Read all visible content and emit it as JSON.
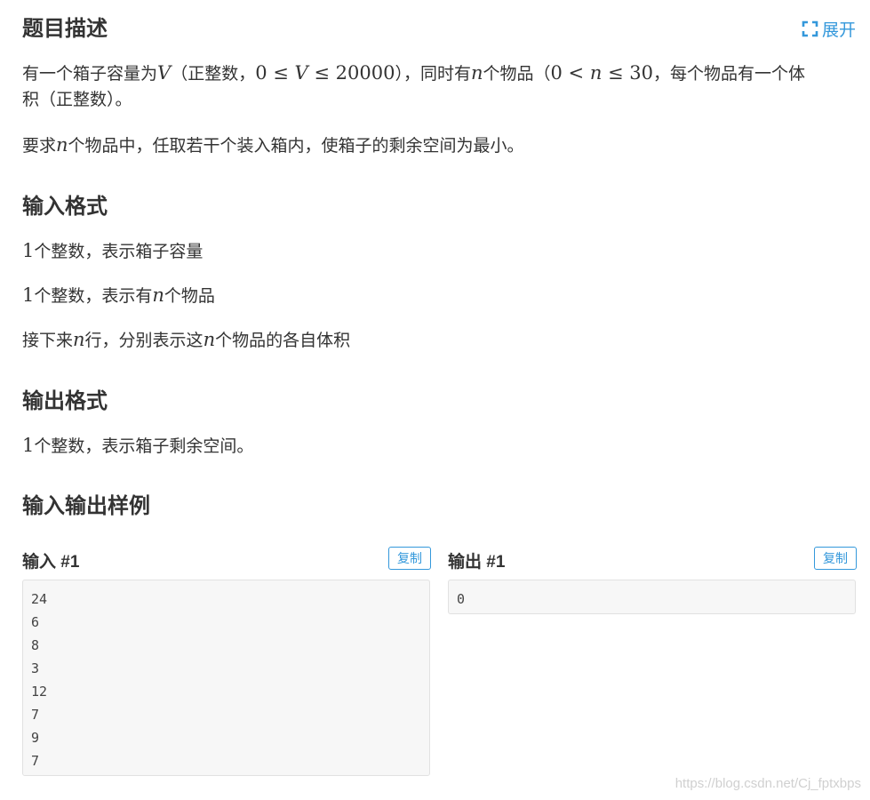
{
  "description": {
    "title": "题目描述",
    "expand_label": "展开",
    "p1_a": "有一个箱子容量为",
    "p1_var_V": "V",
    "p1_b": "（正整数，",
    "p1_math1": "0 ≤ ",
    "p1_math1_var": "V",
    "p1_math1_b": " ≤ 20000",
    "p1_c": "），同时有",
    "p1_var_n": "n",
    "p1_d": "个物品（",
    "p1_math2": "0 < ",
    "p1_math2_var": "n",
    "p1_math2_b": " ≤ 30",
    "p1_e": "，每个物品有一个体",
    "p1_line2": "积（正整数）。",
    "p2_a": "要求",
    "p2_var_n": "n",
    "p2_b": "个物品中，任取若干个装入箱内，使箱子的剩余空间为最小。"
  },
  "input_format": {
    "title": "输入格式",
    "line1_num": "1",
    "line1_text": "个整数，表示箱子容量",
    "line2_num": "1",
    "line2_a": "个整数，表示有",
    "line2_var": "n",
    "line2_b": "个物品",
    "line3_a": "接下来",
    "line3_var": "n",
    "line3_b": "行，分别表示这",
    "line3_var2": "n",
    "line3_c": "个物品的各自体积"
  },
  "output_format": {
    "title": "输出格式",
    "line1_num": "1",
    "line1_text": "个整数，表示箱子剩余空间。"
  },
  "samples": {
    "title": "输入输出样例",
    "input_label": "输入 #1",
    "output_label": "输出 #1",
    "copy_label": "复制",
    "input_lines": [
      "24",
      "6",
      "8",
      "3",
      "12",
      "7",
      "9",
      "7"
    ],
    "output_lines": [
      "0"
    ]
  },
  "watermark": "https://blog.csdn.net/Cj_fptxbps",
  "colors": {
    "accent": "#3498db",
    "text": "#333333",
    "code_bg": "#f7f7f7",
    "code_border": "#e1e1e1"
  },
  "icons": {
    "expand": "expand-icon"
  }
}
